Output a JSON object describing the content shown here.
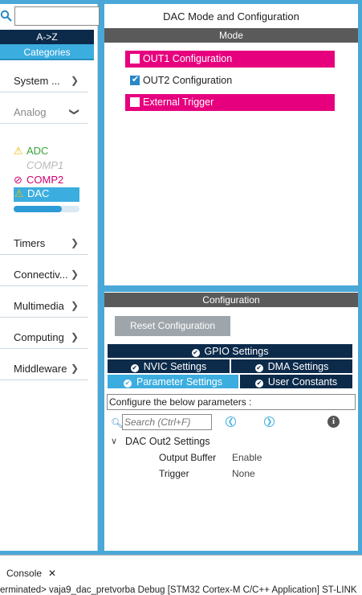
{
  "left": {
    "az_label": "A->Z",
    "categories_label": "Categories",
    "items": [
      {
        "label": "System ...",
        "chevron": ">"
      },
      {
        "label": "Analog",
        "chevron": "v"
      },
      {
        "label": "Timers",
        "chevron": ">"
      },
      {
        "label": "Connectiv...",
        "chevron": ">"
      },
      {
        "label": "Multimedia",
        "chevron": ">"
      },
      {
        "label": "Computing",
        "chevron": ">"
      },
      {
        "label": "Middleware",
        "chevron": ">"
      }
    ],
    "analog_subitems": [
      {
        "label": "ADC",
        "status": "warning",
        "color": "#3aa53a"
      },
      {
        "label": "COMP1",
        "status": "disabled",
        "color": "#b8b8b8"
      },
      {
        "label": "COMP2",
        "status": "blocked",
        "color": "#d1006f"
      },
      {
        "label": "DAC",
        "status": "warning-selected",
        "color": "#ffffff"
      }
    ],
    "dac_scroll_fraction": 0.73
  },
  "mode_panel": {
    "title": "DAC Mode and Configuration",
    "section": "Mode",
    "options": [
      {
        "label": "OUT1 Configuration",
        "checked": false,
        "highlight": true
      },
      {
        "label": "OUT2 Configuration",
        "checked": true,
        "highlight": false
      },
      {
        "label": "External Trigger",
        "checked": false,
        "highlight": true
      }
    ]
  },
  "config_panel": {
    "section": "Configuration",
    "reset_label": "Reset Configuration",
    "tabs": {
      "gpio": "GPIO Settings",
      "nvic": "NVIC Settings",
      "dma": "DMA Settings",
      "parameter": "Parameter Settings",
      "user": "User Constants"
    },
    "hint": "Configure the below parameters :",
    "search_placeholder": "Search (Ctrl+F)",
    "group_title": "DAC Out2 Settings",
    "params": [
      {
        "name": "Output Buffer",
        "value": "Enable"
      },
      {
        "name": "Trigger",
        "value": "None"
      }
    ]
  },
  "console": {
    "tab_label": "Console",
    "line": "erminated> vaja9_dac_pretvorba Debug [STM32 Cortex-M C/C++ Application] ST-LINK"
  },
  "colors": {
    "accent": "#3caddf",
    "navy": "#0c2a4a",
    "pink": "#e6007e",
    "section_grey": "#5a5a5a"
  }
}
